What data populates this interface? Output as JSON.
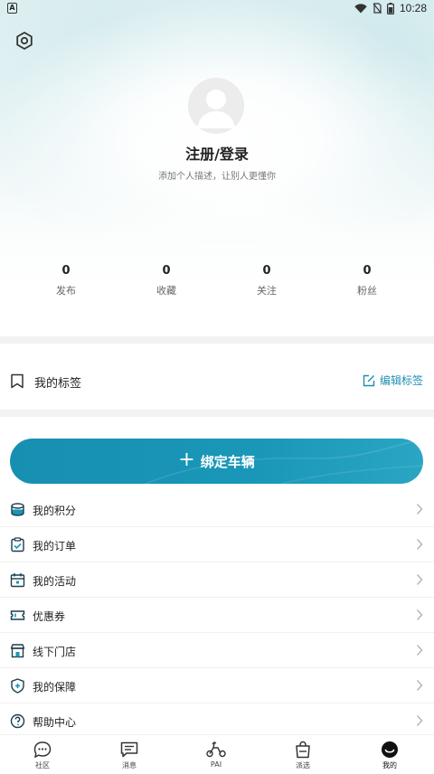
{
  "status_bar": {
    "time": "10:28",
    "left_icon_letter": "A",
    "icons": [
      "wifi-icon",
      "no-sim-icon",
      "battery-icon"
    ]
  },
  "header": {
    "settings_icon": "gear-icon"
  },
  "profile": {
    "title": "注册/登录",
    "description": "添加个人描述，让别人更懂你"
  },
  "stats": [
    {
      "value": "0",
      "label": "发布"
    },
    {
      "value": "0",
      "label": "收藏"
    },
    {
      "value": "0",
      "label": "关注"
    },
    {
      "value": "0",
      "label": "粉丝"
    }
  ],
  "tags": {
    "label": "我的标签",
    "edit_label": "编辑标签"
  },
  "bind_vehicle": {
    "label": "绑定车辆",
    "icon": "+"
  },
  "menu": [
    {
      "label": "我的积分",
      "icon": "coins-icon"
    },
    {
      "label": "我的订单",
      "icon": "order-icon"
    },
    {
      "label": "我的活动",
      "icon": "activity-icon"
    },
    {
      "label": "优惠券",
      "icon": "coupon-icon"
    },
    {
      "label": "线下门店",
      "icon": "store-icon"
    },
    {
      "label": "我的保障",
      "icon": "shield-icon"
    },
    {
      "label": "帮助中心",
      "icon": "help-icon"
    }
  ],
  "tabbar": [
    {
      "label": "社区",
      "icon": "community-icon"
    },
    {
      "label": "消息",
      "icon": "message-icon"
    },
    {
      "label": "PAI",
      "icon": "scooter-icon"
    },
    {
      "label": "派选",
      "icon": "shopping-bag-icon"
    },
    {
      "label": "我的",
      "icon": "profile-face-icon",
      "active": true
    }
  ],
  "colors": {
    "accent": "#1a94b6",
    "link": "#1e8fb0"
  }
}
